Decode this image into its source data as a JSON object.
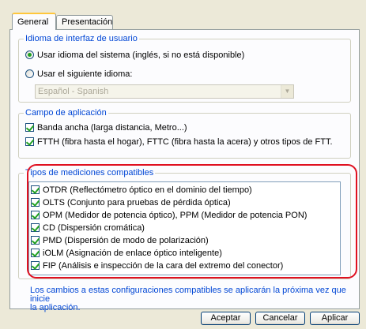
{
  "tabs": [
    {
      "label": "General",
      "active": true
    },
    {
      "label": "Presentación",
      "active": false
    }
  ],
  "language_group": {
    "legend": "Idioma de interfaz de usuario",
    "option_system": "Usar idioma del sistema (inglés, si no está disponible)",
    "option_custom": "Usar el siguiente idioma:",
    "selected": "option_system",
    "language_select_value": "Español - Spanish"
  },
  "application_group": {
    "legend": "Campo de aplicación",
    "items": [
      {
        "label": "Banda ancha (larga distancia, Metro...)",
        "checked": true
      },
      {
        "label": "FTTH (fibra hasta el hogar), FTTC (fibra hasta la acera) y otros tipos de FTT.",
        "checked": true
      }
    ]
  },
  "measurements_group": {
    "legend": "Tipos de mediciones compatibles",
    "items": [
      {
        "label": "OTDR (Reflectómetro óptico en el dominio del tiempo)",
        "checked": true
      },
      {
        "label": "OLTS (Conjunto para pruebas de pérdida óptica)",
        "checked": true
      },
      {
        "label": "OPM (Medidor de potencia óptico), PPM (Medidor de potencia PON)",
        "checked": true
      },
      {
        "label": "CD (Dispersión cromática)",
        "checked": true
      },
      {
        "label": "PMD (Dispersión de modo de polarización)",
        "checked": true
      },
      {
        "label": "iOLM (Asignación de enlace óptico inteligente)",
        "checked": true
      },
      {
        "label": "FIP (Análisis e inspección de la cara del extremo del conector)",
        "checked": true
      }
    ]
  },
  "note": {
    "line1": "Los cambios a estas configuraciones compatibles se aplicarán la próxima vez que inicie",
    "line2": "la aplicación."
  },
  "buttons": {
    "accept": "Aceptar",
    "cancel": "Cancelar",
    "apply": "Aplicar"
  },
  "colors": {
    "accent_text": "#0046d5",
    "highlight_border": "#e01020",
    "check_mark": "#21a121"
  }
}
